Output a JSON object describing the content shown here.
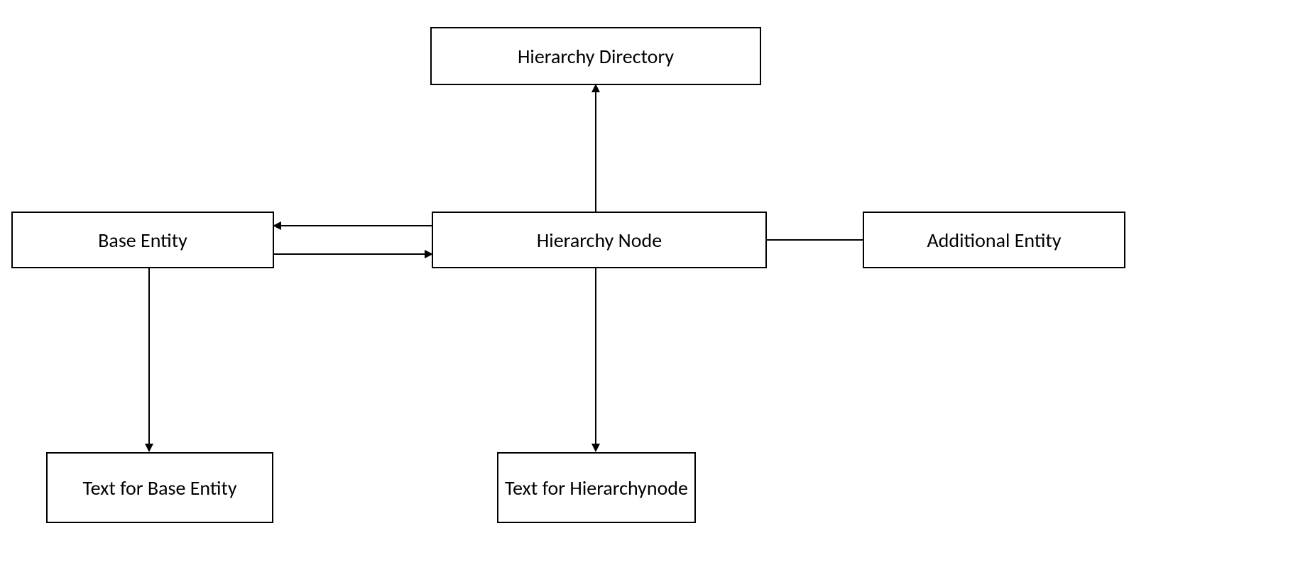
{
  "nodes": {
    "hierarchyDirectory": {
      "label": "Hierarchy Directory"
    },
    "baseEntity": {
      "label": "Base Entity"
    },
    "hierarchyNode": {
      "label": "Hierarchy Node"
    },
    "additionalEntity": {
      "label": "Additional Entity"
    },
    "textForBaseEntity": {
      "label": "Text for Base Entity"
    },
    "textForHierarchyNode": {
      "label": "Text for Hierarchynode"
    }
  },
  "edges": [
    {
      "from": "hierarchyNode",
      "to": "hierarchyDirectory",
      "type": "arrow"
    },
    {
      "from": "hierarchyNode",
      "to": "baseEntity",
      "type": "arrow"
    },
    {
      "from": "baseEntity",
      "to": "hierarchyNode",
      "type": "arrow"
    },
    {
      "from": "hierarchyNode",
      "to": "additionalEntity",
      "type": "line"
    },
    {
      "from": "baseEntity",
      "to": "textForBaseEntity",
      "type": "arrow"
    },
    {
      "from": "hierarchyNode",
      "to": "textForHierarchyNode",
      "type": "arrow"
    }
  ]
}
